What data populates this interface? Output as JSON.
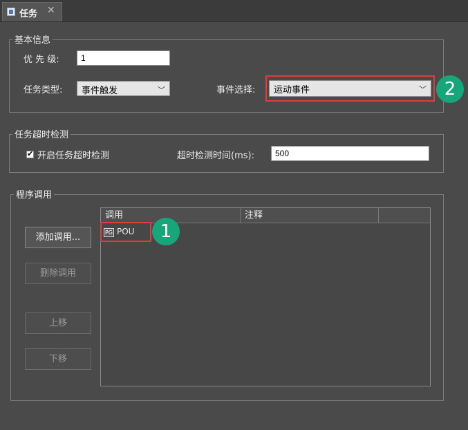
{
  "tab": {
    "title": "任务",
    "close_symbol": "✕"
  },
  "basic_info": {
    "legend": "基本信息",
    "priority_label": "优 先 级:",
    "priority_value": "1",
    "task_type_label": "任务类型:",
    "task_type_value": "事件触发",
    "event_select_label": "事件选择:",
    "event_select_value": "运动事件"
  },
  "timeout": {
    "legend": "任务超时检测",
    "enable_label": "开启任务超时检测",
    "enabled": true,
    "time_label": "超时检测时间(ms):",
    "time_value": "500"
  },
  "program_call": {
    "legend": "程序调用",
    "buttons": {
      "add": "添加调用...",
      "delete": "删除调用",
      "up": "上移",
      "down": "下移"
    },
    "columns": [
      "调用",
      "注释"
    ],
    "rows": [
      {
        "call": "POU",
        "icon_text": "PG"
      }
    ]
  },
  "annotations": {
    "badge_1": "1",
    "badge_2": "2"
  },
  "colors": {
    "highlight": "#e03c3c",
    "badge": "#17a679",
    "background": "#4a4a4a"
  }
}
